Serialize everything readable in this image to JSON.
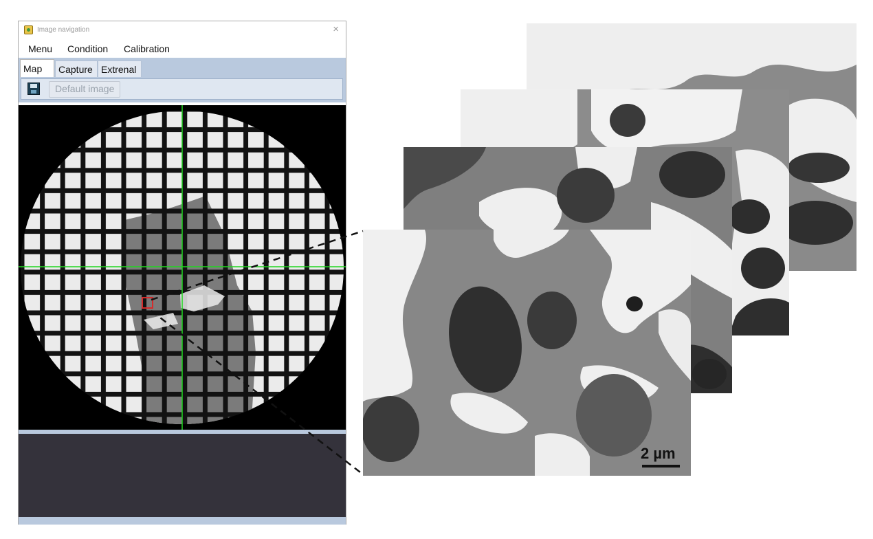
{
  "window": {
    "title": "Image navigation",
    "close_glyph": "×",
    "app_icon": "app-icon"
  },
  "menu": {
    "items": [
      "Menu",
      "Condition",
      "Calibration"
    ]
  },
  "tabs": {
    "items": [
      "Map",
      "Capture",
      "Extrenal"
    ],
    "active": "Map"
  },
  "toolbar": {
    "save_icon": "save-icon",
    "default_image_label": "Default image"
  },
  "map": {
    "crosshair_color": "#1fd61f",
    "selection_color": "#d62b2b",
    "grid_background": "#000000"
  },
  "micrographs": {
    "scale_label": "2 µm",
    "layer_count": 4
  },
  "colors": {
    "chrome_blue": "#b9c9de",
    "status_panel": "#34323b"
  }
}
